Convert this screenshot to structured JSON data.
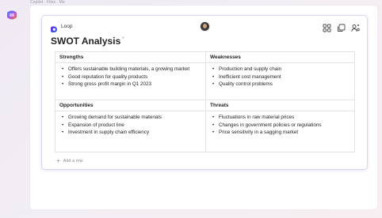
{
  "header": {
    "hint": "Copilot · Files · Me"
  },
  "loop": {
    "app_label": "Loop",
    "title": "SWOT Analysis",
    "title_mark": "*"
  },
  "swot": {
    "strengths": {
      "heading": "Strengths",
      "items": [
        "Offers sustainable building materials, a growing market",
        "Good reputation for quality products",
        "Strong gross profit margin in Q1 2023"
      ]
    },
    "weaknesses": {
      "heading": "Weaknesses",
      "items": [
        "Production and supply chain",
        "Inefficient cost management",
        "Quality control problems"
      ]
    },
    "opportunities": {
      "heading": "Opportunities",
      "items": [
        "Growing demand for sustainable materials",
        "Expansion of product line",
        "Investment in supply chain efficiency"
      ]
    },
    "threats": {
      "heading": "Threats",
      "items": [
        "Fluctuations in raw material prices",
        "Changes in government policies or regulations",
        "Price sensitivity in a sagging market"
      ]
    }
  },
  "add_row": {
    "plus": "+",
    "label": "Add a row"
  },
  "colors": {
    "accent": "#7b61ff",
    "card_border": "#d9d4ef",
    "text": "#242424"
  },
  "icons": [
    "copilot-icon",
    "loop-icon",
    "avatar",
    "components-icon",
    "copy-icon",
    "share-icon"
  ]
}
